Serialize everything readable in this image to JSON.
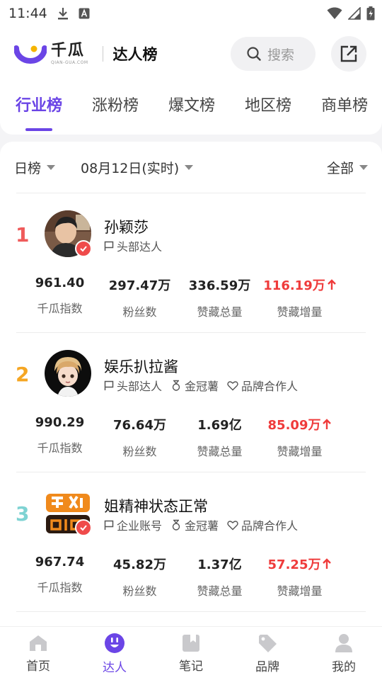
{
  "status": {
    "time": "11:44"
  },
  "app": {
    "logo_main": "千瓜",
    "logo_sub": "QIAN-GUA.COM",
    "title": "达人榜"
  },
  "search": {
    "placeholder": "搜索"
  },
  "tabs": [
    {
      "label": "行业榜",
      "active": true
    },
    {
      "label": "涨粉榜",
      "active": false
    },
    {
      "label": "爆文榜",
      "active": false
    },
    {
      "label": "地区榜",
      "active": false
    },
    {
      "label": "商单榜",
      "active": false
    }
  ],
  "filters": {
    "period": "日榜",
    "date": "08月12日(实时)",
    "scope": "全部"
  },
  "stat_labels": {
    "index": "千瓜指数",
    "fans": "粉丝数",
    "likes": "赞藏总量",
    "growth": "赞藏增量"
  },
  "colors": {
    "accent": "#6b45e6",
    "rank1": "#ef5b5b",
    "rank2": "#f5a623",
    "rank3": "#7fd3d3",
    "up": "#ef3b3b"
  },
  "rows": [
    {
      "rank": "1",
      "name": "孙颖莎",
      "tags": [
        {
          "icon": "flag-icon",
          "text": "头部达人"
        }
      ],
      "index": "961.40",
      "fans": "297.47万",
      "likes": "336.59万",
      "growth": "116.19万",
      "verified": true
    },
    {
      "rank": "2",
      "name": "娱乐扒拉酱",
      "tags": [
        {
          "icon": "flag-icon",
          "text": "头部达人"
        },
        {
          "icon": "medal-icon",
          "text": "金冠薯"
        },
        {
          "icon": "heart-icon",
          "text": "品牌合作人"
        }
      ],
      "index": "990.29",
      "fans": "76.64万",
      "likes": "1.69亿",
      "growth": "85.09万",
      "verified": false
    },
    {
      "rank": "3",
      "name": "姐精神状态正常",
      "tags": [
        {
          "icon": "flag-icon",
          "text": "企业账号"
        },
        {
          "icon": "medal-icon",
          "text": "金冠薯"
        },
        {
          "icon": "heart-icon",
          "text": "品牌合作人"
        }
      ],
      "index": "967.74",
      "fans": "45.82万",
      "likes": "1.37亿",
      "growth": "57.25万",
      "verified": true
    }
  ],
  "nav": [
    {
      "label": "首页",
      "icon": "home-icon",
      "active": false
    },
    {
      "label": "达人",
      "icon": "influencer-icon",
      "active": true
    },
    {
      "label": "笔记",
      "icon": "notes-icon",
      "active": false
    },
    {
      "label": "品牌",
      "icon": "brand-tag-icon",
      "active": false
    },
    {
      "label": "我的",
      "icon": "profile-icon",
      "active": false
    }
  ]
}
